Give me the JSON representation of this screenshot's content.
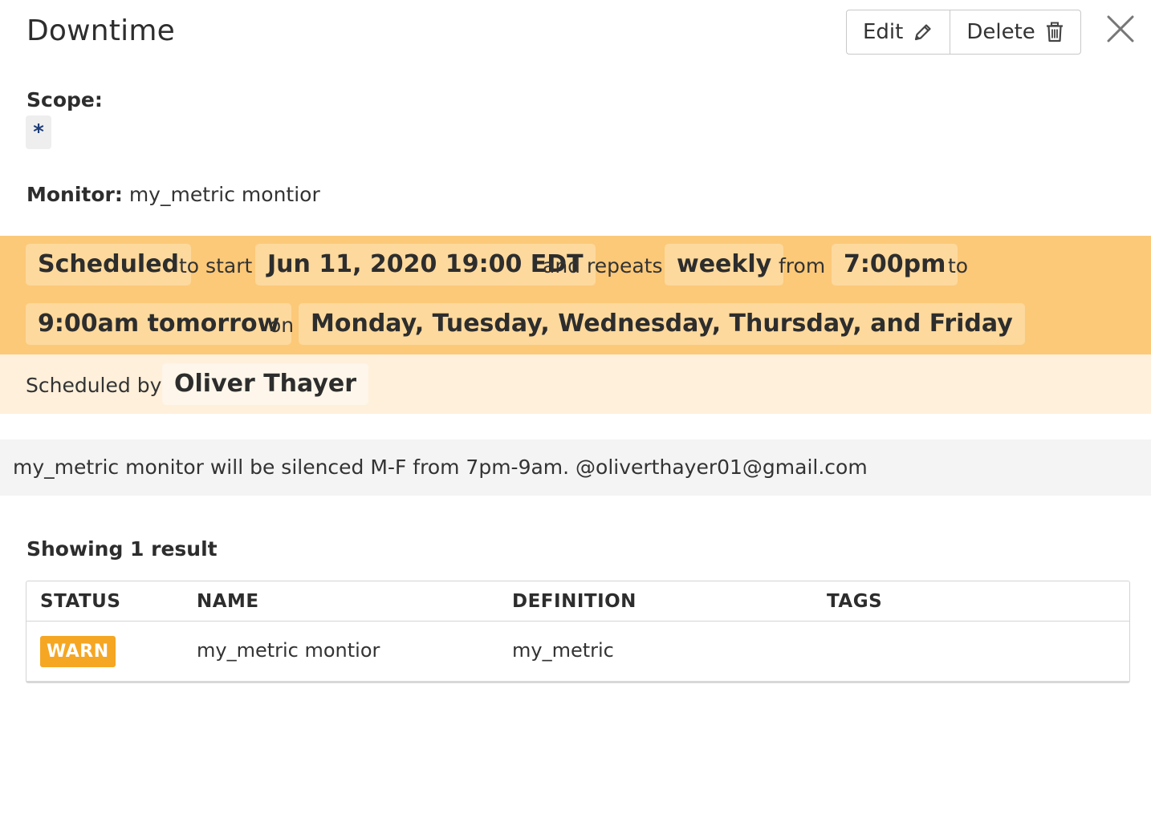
{
  "header": {
    "title": "Downtime",
    "edit_label": "Edit",
    "delete_label": "Delete"
  },
  "scope": {
    "label": "Scope:",
    "value": "*"
  },
  "monitor": {
    "label": "Monitor:",
    "value": "my_metric montior"
  },
  "schedule": {
    "status": "Scheduled",
    "to_start": "to start",
    "start_time": "Jun 11, 2020 19:00 EDT",
    "and_repeats": "and repeats",
    "frequency": "weekly",
    "from": "from",
    "from_time": "7:00pm",
    "to": "to",
    "to_time": "9:00am tomorrow",
    "on": "on",
    "days": "Monday, Tuesday, Wednesday, Thursday, and Friday"
  },
  "scheduled_by": {
    "label": "Scheduled by",
    "name": "Oliver Thayer"
  },
  "message": "my_metric monitor will be silenced M-F from 7pm-9am. @oliverthayer01@gmail.com",
  "results": {
    "summary": "Showing 1 result",
    "columns": [
      "STATUS",
      "NAME",
      "DEFINITION",
      "TAGS"
    ],
    "rows": [
      {
        "status": "WARN",
        "name": "my_metric montior",
        "definition": "my_metric",
        "tags": ""
      }
    ]
  },
  "colors": {
    "schedule_band": "#fcc979",
    "chip": "#fdd99d",
    "by_band": "#fef0db",
    "warn": "#f5a623",
    "scope_text": "#1d3d78"
  },
  "icons": [
    "pencil-icon",
    "trash-icon",
    "close-icon"
  ]
}
